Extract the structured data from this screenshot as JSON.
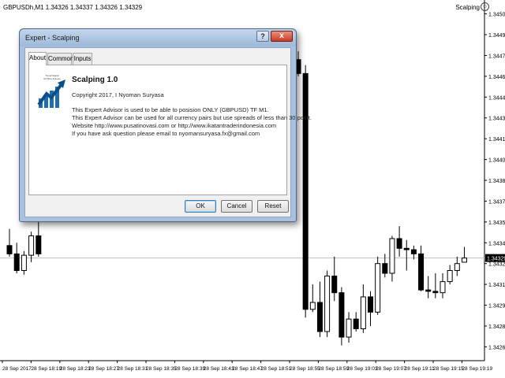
{
  "chart": {
    "symbol_info": "GBPUSDh,M1  1.34326 1.34337 1.34326 1.34329",
    "ea_label": "Scalping",
    "ea_icon": "smiley-icon"
  },
  "chart_data": {
    "type": "candlestick",
    "y_ticks": [
      "1.34505",
      "1.34490",
      "1.34475",
      "1.34460",
      "1.34445",
      "1.34430",
      "1.34415",
      "1.34400",
      "1.34385",
      "1.34370",
      "1.34355",
      "1.34340",
      "1.34325",
      "1.34310",
      "1.34295",
      "1.34280",
      "1.34265"
    ],
    "ylim": [
      1.34255,
      1.34515
    ],
    "x_ticks": [
      "28 Sep 2017",
      "28 Sep 18:19",
      "28 Sep 18:23",
      "28 Sep 18:27",
      "28 Sep 18:31",
      "28 Sep 18:35",
      "28 Sep 18:39",
      "28 Sep 18:43",
      "28 Sep 18:47",
      "28 Sep 18:51",
      "28 Sep 18:55",
      "28 Sep 18:59",
      "28 Sep 19:03",
      "28 Sep 19:07",
      "28 Sep 19:11",
      "28 Sep 19:15",
      "28 Sep 19:19"
    ],
    "current_price": "1.34329",
    "current_price_value": 1.34329,
    "candles_left": [
      {
        "o": 1.34338,
        "h": 1.3435,
        "l": 1.3433,
        "c": 1.34332
      },
      {
        "o": 1.34332,
        "h": 1.3434,
        "l": 1.34318,
        "c": 1.3432
      },
      {
        "o": 1.3432,
        "h": 1.34334,
        "l": 1.34317,
        "c": 1.34331
      },
      {
        "o": 1.34331,
        "h": 1.34348,
        "l": 1.34326,
        "c": 1.34345
      },
      {
        "o": 1.34345,
        "h": 1.34358,
        "l": 1.3433,
        "c": 1.34332
      }
    ],
    "candles_right": [
      {
        "o": 1.34472,
        "h": 1.34478,
        "l": 1.3446,
        "c": 1.34462
      },
      {
        "o": 1.34462,
        "h": 1.34468,
        "l": 1.34286,
        "c": 1.34292
      },
      {
        "o": 1.34292,
        "h": 1.3431,
        "l": 1.3429,
        "c": 1.34297
      },
      {
        "o": 1.34297,
        "h": 1.34312,
        "l": 1.34272,
        "c": 1.34276
      },
      {
        "o": 1.34276,
        "h": 1.3432,
        "l": 1.34272,
        "c": 1.34316
      },
      {
        "o": 1.34316,
        "h": 1.3433,
        "l": 1.34298,
        "c": 1.34304
      },
      {
        "o": 1.34304,
        "h": 1.34308,
        "l": 1.34266,
        "c": 1.34272
      },
      {
        "o": 1.34272,
        "h": 1.3429,
        "l": 1.34268,
        "c": 1.34285
      },
      {
        "o": 1.34285,
        "h": 1.3429,
        "l": 1.34276,
        "c": 1.34278
      },
      {
        "o": 1.34278,
        "h": 1.3431,
        "l": 1.34275,
        "c": 1.34301
      },
      {
        "o": 1.34301,
        "h": 1.34305,
        "l": 1.3428,
        "c": 1.3429
      },
      {
        "o": 1.3429,
        "h": 1.3433,
        "l": 1.34288,
        "c": 1.34325
      },
      {
        "o": 1.34325,
        "h": 1.34332,
        "l": 1.34315,
        "c": 1.34318
      },
      {
        "o": 1.34318,
        "h": 1.34345,
        "l": 1.34312,
        "c": 1.34343
      },
      {
        "o": 1.34343,
        "h": 1.34352,
        "l": 1.3433,
        "c": 1.34336
      },
      {
        "o": 1.34336,
        "h": 1.34342,
        "l": 1.3432,
        "c": 1.34335
      },
      {
        "o": 1.34335,
        "h": 1.34338,
        "l": 1.34328,
        "c": 1.34332
      },
      {
        "o": 1.34332,
        "h": 1.34338,
        "l": 1.34305,
        "c": 1.34306
      },
      {
        "o": 1.34306,
        "h": 1.34316,
        "l": 1.343,
        "c": 1.34305
      },
      {
        "o": 1.34305,
        "h": 1.34318,
        "l": 1.343,
        "c": 1.34304
      },
      {
        "o": 1.34304,
        "h": 1.34318,
        "l": 1.343,
        "c": 1.34312
      },
      {
        "o": 1.34312,
        "h": 1.34324,
        "l": 1.3431,
        "c": 1.3432
      },
      {
        "o": 1.3432,
        "h": 1.3433,
        "l": 1.34316,
        "c": 1.34325
      },
      {
        "o": 1.34326,
        "h": 1.34337,
        "l": 1.34326,
        "c": 1.34329
      }
    ],
    "up_color": "#ffffff",
    "down_color": "#000000",
    "grid": false
  },
  "dialog": {
    "title": "Expert - Scalping",
    "help_label": "?",
    "close_label": "x",
    "tabs": [
      "About",
      "Common",
      "Inputs"
    ],
    "active_tab": "About",
    "logo_caption": "Trend Signal\nAll Time Frames",
    "logo_icon": "trend-arrow-logo-icon",
    "ea_name": "Scalping 1.0",
    "copyright": "Copyright 2017, I Nyoman Suryasa",
    "description": [
      "This Expert Advisor is used to be able to posision ONLY (GBPUSD) TF M1.",
      "This Expert Advisor can be used for all currency pairs but use spreads of less than 30 point.",
      "Website http://www.pusatinovasi.com or http://www.ikatantraderindonesia.com",
      "If you have ask question please email to nyomansuryasa.fx@gmail.com"
    ],
    "buttons": {
      "ok": "OK",
      "cancel": "Cancel",
      "reset": "Reset"
    }
  }
}
